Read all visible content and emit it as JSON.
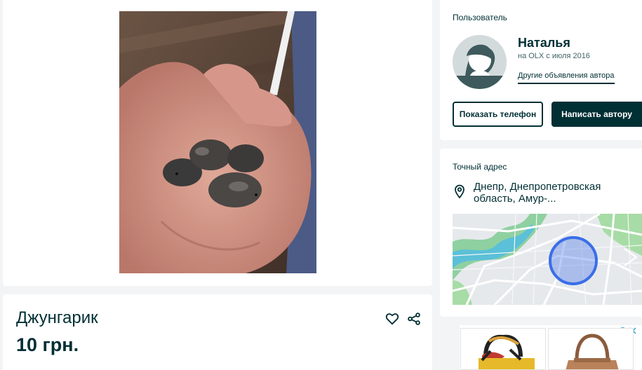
{
  "listing": {
    "title": "Джунгарик",
    "price": "10 грн."
  },
  "user": {
    "section_label": "Пользователь",
    "name": "Наталья",
    "since": "на OLX с июля 2016",
    "other_ads_link": "Другие объявления автора",
    "show_phone_label": "Показать телефон",
    "write_author_label": "Написать автору"
  },
  "location": {
    "section_label": "Точный адрес",
    "address": "Днепр, Днепропетровская область, Амур-..."
  },
  "icons": {
    "favorite": "heart-icon",
    "share": "share-icon",
    "location": "map-pin-icon",
    "ad_info": "info-icon",
    "ad_close": "close-icon"
  },
  "ad": {
    "info_glyph": "i"
  },
  "colors": {
    "primary": "#002f34",
    "background": "#f2f4f5",
    "map_radius": "#3a6ee8"
  }
}
